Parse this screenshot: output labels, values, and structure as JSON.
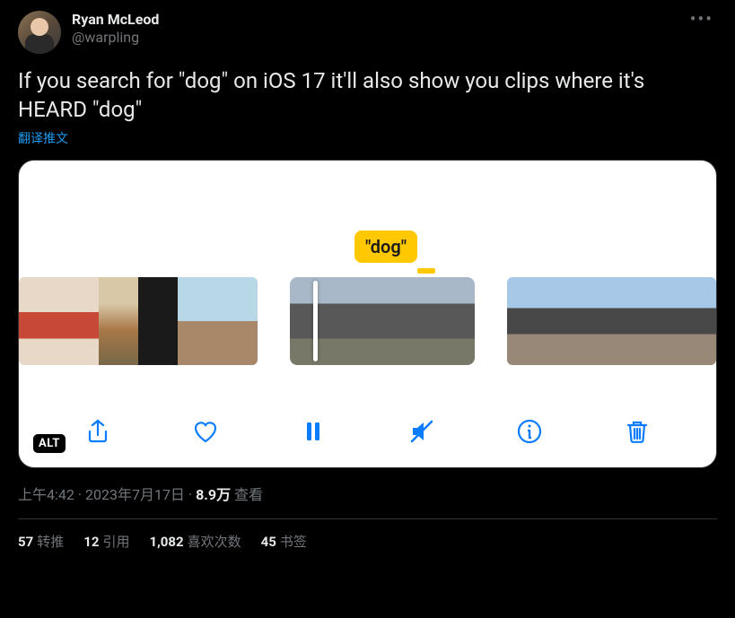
{
  "author": {
    "display_name": "Ryan McLeod",
    "handle": "@warpling"
  },
  "tweet_text": "If you search for \"dog\" on iOS 17 it'll also show you clips where it's HEARD \"dog\"",
  "translate_label": "翻译推文",
  "media": {
    "search_token": "\"dog\"",
    "alt_badge": "ALT",
    "toolbar_icons": [
      "share-icon",
      "heart-icon",
      "pause-icon",
      "mute-icon",
      "info-icon",
      "trash-icon"
    ]
  },
  "meta": {
    "time": "上午4:42",
    "date": "2023年7月17日",
    "separator": " · ",
    "views_count": "8.9万",
    "views_label": " 查看"
  },
  "stats": {
    "retweets": {
      "count": "57",
      "label": "转推"
    },
    "quotes": {
      "count": "12",
      "label": "引用"
    },
    "likes": {
      "count": "1,082",
      "label": "喜欢次数"
    },
    "bookmarks": {
      "count": "45",
      "label": "书签"
    }
  }
}
